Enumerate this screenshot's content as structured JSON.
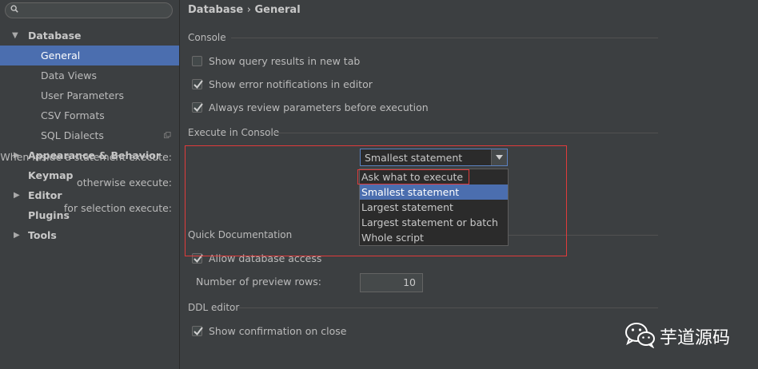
{
  "sidebar": {
    "search": {
      "placeholder": ""
    },
    "items": [
      {
        "label": "Database",
        "level": 0,
        "expanded": true,
        "bold": true
      },
      {
        "label": "General",
        "level": 1,
        "selected": true
      },
      {
        "label": "Data Views",
        "level": 1
      },
      {
        "label": "User Parameters",
        "level": 1
      },
      {
        "label": "CSV Formats",
        "level": 1
      },
      {
        "label": "SQL Dialects",
        "level": 1
      },
      {
        "label": "Appearance & Behavior",
        "level": 0,
        "expanded": false,
        "bold": true
      },
      {
        "label": "Keymap",
        "level": 0,
        "bold": true
      },
      {
        "label": "Editor",
        "level": 0,
        "expanded": false,
        "bold": true
      },
      {
        "label": "Plugins",
        "level": 0,
        "bold": true
      },
      {
        "label": "Tools",
        "level": 0,
        "expanded": false,
        "bold": true
      }
    ]
  },
  "breadcrumb": {
    "parent": "Database",
    "separator": "›",
    "current": "General"
  },
  "console": {
    "title": "Console",
    "options": [
      {
        "label": "Show query results in new tab",
        "checked": false
      },
      {
        "label": "Show error notifications in editor",
        "checked": true
      },
      {
        "label": "Always review parameters before execution",
        "checked": true
      }
    ]
  },
  "execute": {
    "title": "Execute in Console",
    "inside_label": "When inside a statement execute:",
    "inside_value": "Smallest statement",
    "otherwise_label": "otherwise execute:",
    "selection_label": "for selection execute:",
    "dropdown_options": [
      "Ask what to execute",
      "Smallest statement",
      "Largest statement",
      "Largest statement or batch",
      "Whole script"
    ],
    "dropdown_selected": "Smallest statement"
  },
  "quickdoc": {
    "title": "Quick Documentation",
    "allow_label": "Allow database access",
    "allow_checked": true,
    "rows_label": "Number of preview rows:",
    "rows_value": "10"
  },
  "ddl": {
    "title": "DDL editor",
    "confirm_label": "Show confirmation on close",
    "confirm_checked": true
  },
  "watermark": {
    "text": "芋道源码"
  },
  "colors": {
    "selection": "#4b6eaf",
    "highlight_box": "#e03b3b",
    "background": "#3c3f41"
  }
}
